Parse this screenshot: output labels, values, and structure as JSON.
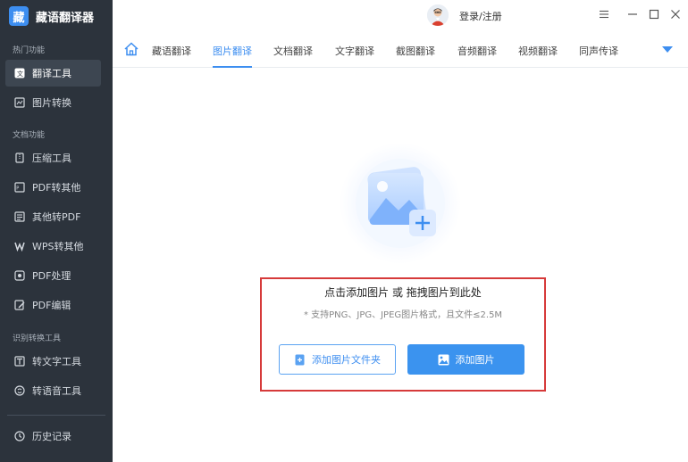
{
  "app": {
    "logo_glyph": "藏",
    "name": "藏语翻译器"
  },
  "sidebar": {
    "sections": [
      {
        "label": "热门功能"
      },
      {
        "label": "文档功能"
      },
      {
        "label": "识别转换工具"
      }
    ],
    "items": [
      {
        "label": "翻译工具",
        "icon": "translate-icon",
        "active": true
      },
      {
        "label": "图片转换",
        "icon": "image-convert-icon"
      },
      {
        "label": "压缩工具",
        "icon": "compress-icon"
      },
      {
        "label": "PDF转其他",
        "icon": "pdf-convert-icon"
      },
      {
        "label": "其他转PDF",
        "icon": "to-pdf-icon"
      },
      {
        "label": "WPS转其他",
        "icon": "wps-icon"
      },
      {
        "label": "PDF处理",
        "icon": "pdf-process-icon"
      },
      {
        "label": "PDF编辑",
        "icon": "pdf-edit-icon"
      },
      {
        "label": "转文字工具",
        "icon": "text-tool-icon"
      },
      {
        "label": "转语音工具",
        "icon": "voice-tool-icon"
      },
      {
        "label": "历史记录",
        "icon": "history-icon"
      }
    ]
  },
  "topbar": {
    "login_label": "登录/注册"
  },
  "tabs": [
    {
      "label": "藏语翻译"
    },
    {
      "label": "图片翻译",
      "active": true
    },
    {
      "label": "文档翻译"
    },
    {
      "label": "文字翻译"
    },
    {
      "label": "截图翻译"
    },
    {
      "label": "音频翻译"
    },
    {
      "label": "视频翻译"
    },
    {
      "label": "同声传译"
    }
  ],
  "upload": {
    "title": "点击添加图片 或 拖拽图片到此处",
    "hint": "* 支持PNG、JPG、JPEG图片格式，且文件≤2.5M",
    "add_folder_label": "添加图片文件夹",
    "add_image_label": "添加图片"
  },
  "colors": {
    "accent": "#3d8ef0",
    "sidebar_bg": "#2c333c",
    "highlight_border": "#d63a3a"
  }
}
